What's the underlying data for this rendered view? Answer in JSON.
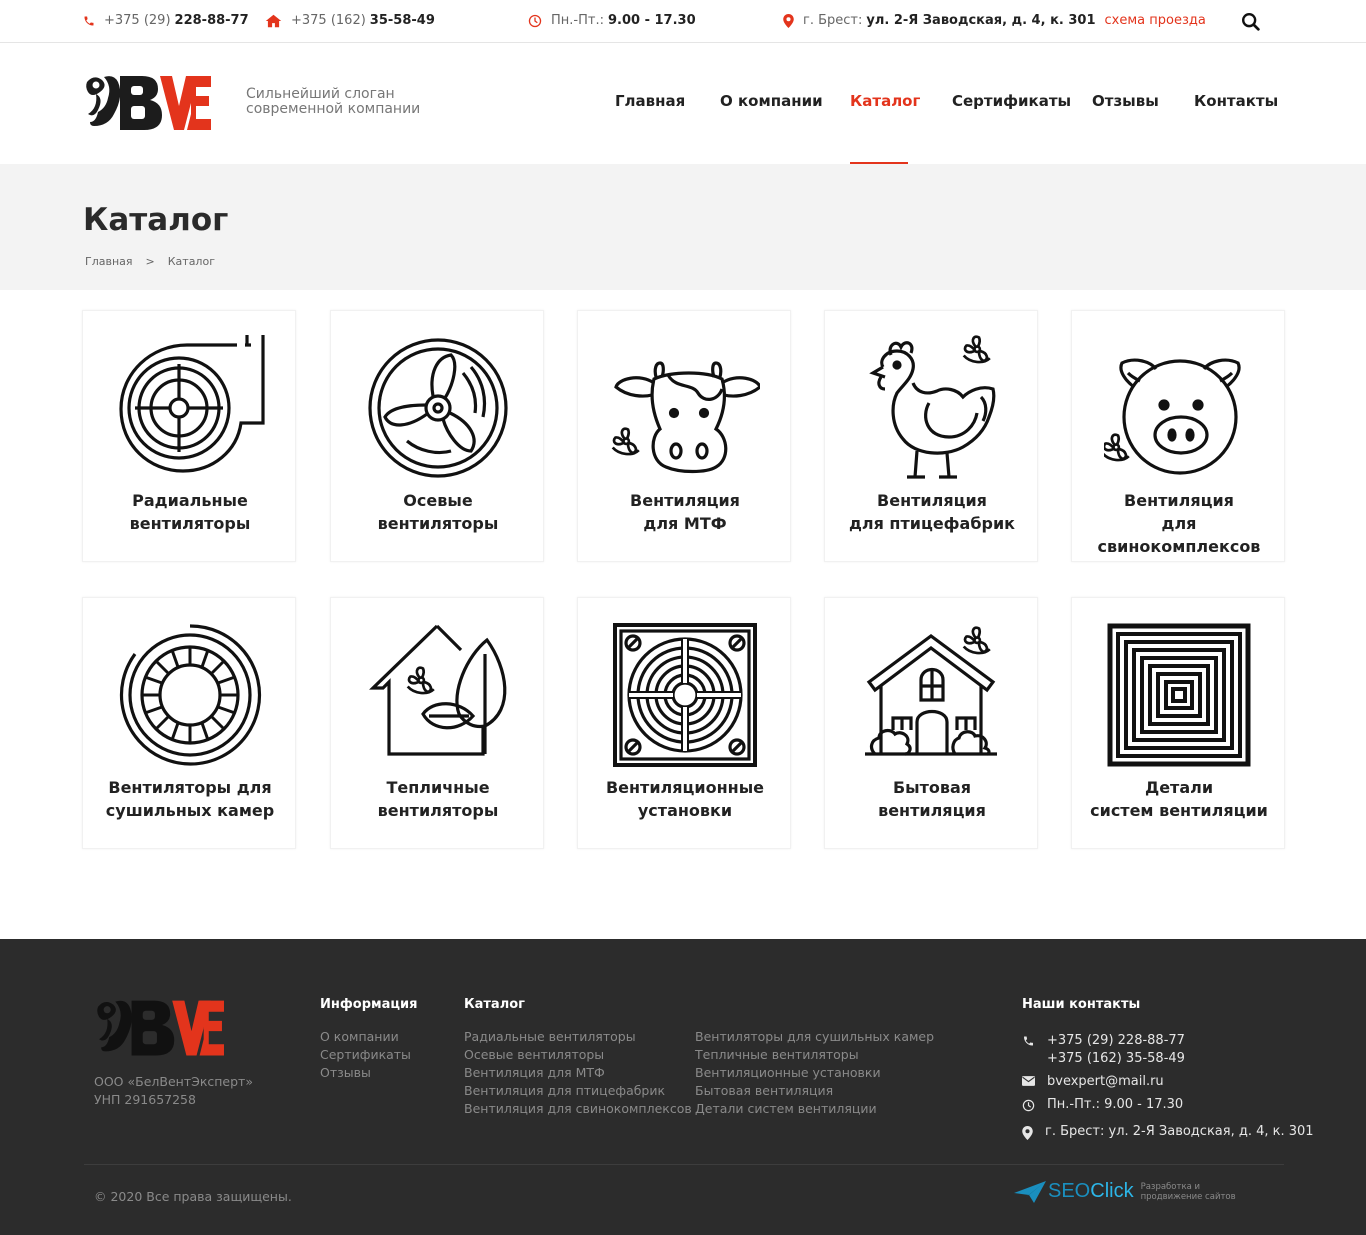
{
  "topbar": {
    "phone1_code": "+375 (29)",
    "phone1_number": "228-88-77",
    "phone2_code": "+375 (162)",
    "phone2_number": "35-58-49",
    "hours_label": "Пн.-Пт.:",
    "hours_value": "9.00 - 17.30",
    "address_label": "г. Брест:",
    "address_value": "ул. 2-Я Заводская, д. 4, к. 301",
    "map_link": "схема проезда"
  },
  "header": {
    "slogan_line1": "Сильнейший слоган",
    "slogan_line2": "современной компании",
    "nav": [
      "Главная",
      "О компании",
      "Каталог",
      "Сертификаты",
      "Отзывы",
      "Контакты"
    ],
    "active_nav": "Каталог"
  },
  "page": {
    "title": "Каталог",
    "breadcrumbs": [
      "Главная",
      "Каталог"
    ],
    "breadcrumb_sep": ">"
  },
  "catalog": [
    {
      "line1": "Радиальные",
      "line2": "вентиляторы",
      "icon": "radial-fan-icon"
    },
    {
      "line1": "Осевые",
      "line2": "вентиляторы",
      "icon": "axial-fan-icon"
    },
    {
      "line1": "Вентиляция",
      "line2": "для МТФ",
      "icon": "cow-icon"
    },
    {
      "line1": "Вентиляция",
      "line2": "для птицефабрик",
      "icon": "chicken-icon"
    },
    {
      "line1": "Вентиляция",
      "line2": "для свинокомплексов",
      "icon": "pig-icon"
    },
    {
      "line1": "Вентиляторы для",
      "line2": "сушильных камер",
      "icon": "drying-fan-icon"
    },
    {
      "line1": "Тепличные",
      "line2": "вентиляторы",
      "icon": "greenhouse-icon"
    },
    {
      "line1": "Вентиляционные",
      "line2": "установки",
      "icon": "ventilation-unit-icon"
    },
    {
      "line1": "Бытовая",
      "line2": "вентиляция",
      "icon": "house-icon"
    },
    {
      "line1": "Детали",
      "line2": "систем вентиляции",
      "icon": "grille-icon"
    }
  ],
  "footer": {
    "company_name": "ООО «БелВентЭксперт»",
    "unp": "УНП 291657258",
    "info_heading": "Информация",
    "info_links": [
      "О компании",
      "Сертификаты",
      "Отзывы"
    ],
    "catalog_heading": "Каталог",
    "catalog_col1": [
      "Радиальные вентиляторы",
      "Осевые вентиляторы",
      "Вентиляция для МТФ",
      "Вентиляция для птицефабрик",
      "Вентиляция для свинокомплексов"
    ],
    "catalog_col2": [
      "Вентиляторы для сушильных камер",
      "Тепличные вентиляторы",
      "Вентиляционные установки",
      "Бытовая вентиляция",
      "Детали систем вентиляции"
    ],
    "contacts_heading": "Наши контакты",
    "phone1": "+375 (29) 228-88-77",
    "phone2": "+375 (162) 35-58-49",
    "email": "bvexpert@mail.ru",
    "hours": "Пн.-Пт.: 9.00 - 17.30",
    "address": "г. Брест: ул. 2-Я Заводская, д. 4, к. 301",
    "copyright": "© 2020 Все права защищены.",
    "dev_brand_a": "SEO",
    "dev_brand_b": "Click",
    "dev_text_1": "Разработка и",
    "dev_text_2": "продвижение сайтов"
  },
  "colors": {
    "accent": "#e3341c",
    "dark": "#1c1c1c",
    "footer_bg": "#2c2c2c",
    "band_bg": "#f3f3f3"
  }
}
